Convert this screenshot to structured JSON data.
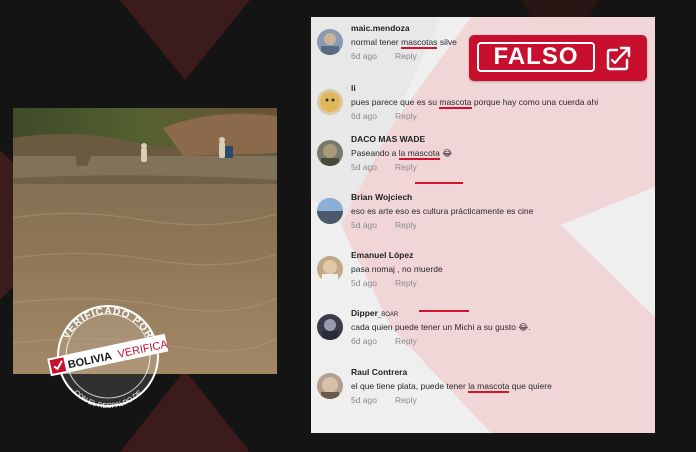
{
  "badge": {
    "label": "FALSO",
    "color": "#c8102e"
  },
  "seal": {
    "top_text": "VERIFICADO POR",
    "brand_bold": "BOLIVIA",
    "brand_light": "VERIFICA",
    "bottom_text": "CON EL RESPALDO DE"
  },
  "comments": [
    {
      "author": "maic.mendoza",
      "author_suffix": "",
      "pre": "normal tener ",
      "hl": "mascotas",
      "post": " silve",
      "age": "6d ago",
      "reply": "Reply"
    },
    {
      "author": "li",
      "author_suffix": "",
      "pre": "pues parece que es su ",
      "hl": "mascota",
      "post": " porque hay como una cuerda ahi",
      "age": "6d ago",
      "reply": "Reply"
    },
    {
      "author": "DACO MAS WADE",
      "author_suffix": "",
      "pre": "Paseando a ",
      "hl": "la mascota",
      "post": " 😂",
      "age": "5d ago",
      "reply": "Reply"
    },
    {
      "author": "Brian Wojciech",
      "author_suffix": "",
      "pre": "eso es arte eso es cultura prácticamente es cine",
      "hl": "",
      "post": "",
      "age": "5d ago",
      "reply": "Reply"
    },
    {
      "author": "Emanuel López",
      "author_suffix": "",
      "pre": "pasa nomaj , no muerde",
      "hl": "",
      "post": "",
      "age": "5d ago",
      "reply": "Reply"
    },
    {
      "author": "Dipper",
      "author_suffix": "_BOAR",
      "pre": "cada quien puede tener un Michi a su gusto 😂.",
      "hl": "",
      "post": "",
      "age": "6d ago",
      "reply": "Reply"
    },
    {
      "author": "Raul Contrera",
      "author_suffix": "",
      "pre": "el que tiene plata, puede tener ",
      "hl": "la mascota",
      "post": " que quiere",
      "age": "5d ago",
      "reply": "Reply"
    }
  ]
}
